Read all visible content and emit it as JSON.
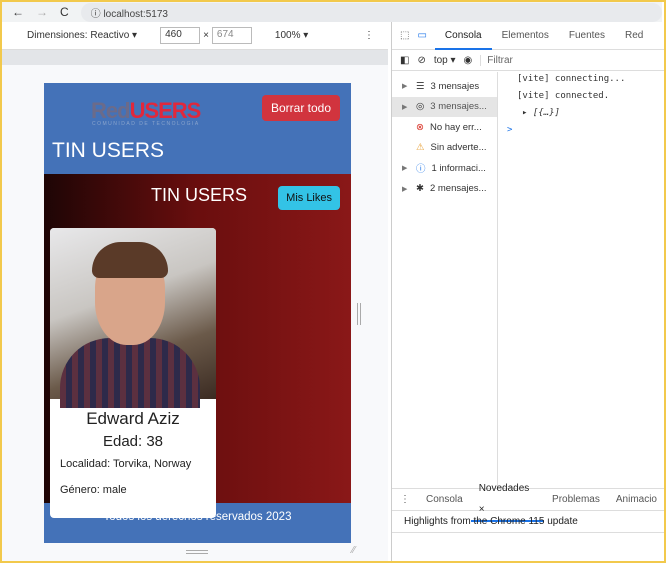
{
  "browser": {
    "url": "localhost:5173"
  },
  "devtools_toolbar": {
    "dimensions_label": "Dimensiones: Reactivo ▾",
    "width": "460",
    "x": "×",
    "height": "674",
    "zoom": "100% ▾"
  },
  "app": {
    "logo_red": "Red",
    "logo_users": "USERS",
    "logo_tagline": "COMUNIDAD DE TECNOLOGIA",
    "clear_button": "Borrar todo",
    "title": "TIN USERS",
    "section_title": "TIN USERS",
    "likes_button": "Mis Likes",
    "card": {
      "name": "Edward Aziz",
      "age": "Edad: 38",
      "location": "Localidad: Torvika, Norway",
      "gender": "Género: male"
    },
    "footer": "Todos los derechos reservados 2023"
  },
  "devtools": {
    "tabs": [
      "Consola",
      "Elementos",
      "Fuentes",
      "Red"
    ],
    "context": "top ▾",
    "filter_placeholder": "Filtrar",
    "sidebar": [
      {
        "icon": "list",
        "label": "3 mensajes"
      },
      {
        "icon": "user",
        "label": "3 mensajes..."
      },
      {
        "icon": "error",
        "label": "No hay err..."
      },
      {
        "icon": "warning",
        "label": "Sin adverte..."
      },
      {
        "icon": "info",
        "label": "1 informaci..."
      },
      {
        "icon": "bug",
        "label": "2 mensajes..."
      }
    ],
    "console": [
      "[vite] connecting...",
      "[vite] connected.",
      "▸ [{…}]",
      ">"
    ],
    "drawer_tabs": [
      "Consola",
      "Novedades ×",
      "Problemas",
      "Animacio"
    ],
    "drawer_text": "Highlights from the Chrome 115 update"
  }
}
